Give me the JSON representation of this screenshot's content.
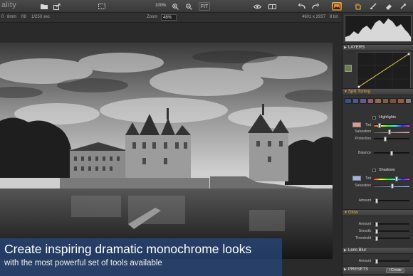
{
  "app": {
    "title_fragment": "ality"
  },
  "toolbar": {
    "zoom_percent": "100%",
    "fit_label": "FIT"
  },
  "infobar": {
    "focal": "8mm",
    "aperture": "f/8",
    "shutter": "1/250 sec",
    "zoom_label": "Zoom",
    "zoom_value": "48%",
    "dimensions": "4601 x 2937",
    "bit_depth": "8 bit",
    "left_digit": "0"
  },
  "caption": {
    "title": "Create inspiring dramatic monochrome looks",
    "subtitle": "with the most powerful set of tools available"
  },
  "panel": {
    "layers_label": "LAYERS",
    "split_toning_label": "Split Toning",
    "highlights_label": "Highlights",
    "shadows_label": "Shadows",
    "tint_label": "Tint",
    "saturation_label": "Saturation",
    "protection_label": "Protection",
    "balance_label": "Balance",
    "amount_label": "Amount",
    "glow_label": "Glow",
    "smooth_label": "Smooth",
    "threshold_label": "Threshold",
    "lens_blur_label": "Lens Blur",
    "presets_label": "PRESETS",
    "create_label": "Create",
    "split_presets": [
      "#3b4f8a",
      "#4a5a92",
      "#6a5a8a",
      "#8a5e6e",
      "#8e6a4e",
      "#7a6048",
      "#805038",
      "#9a5a40",
      "#7a7a7a"
    ],
    "highlight_tint_color": "#e09a86",
    "shadow_tint_color": "#9fb4e6"
  },
  "colors": {
    "accent": "#e08b2c",
    "caption_bg": "#284678"
  }
}
